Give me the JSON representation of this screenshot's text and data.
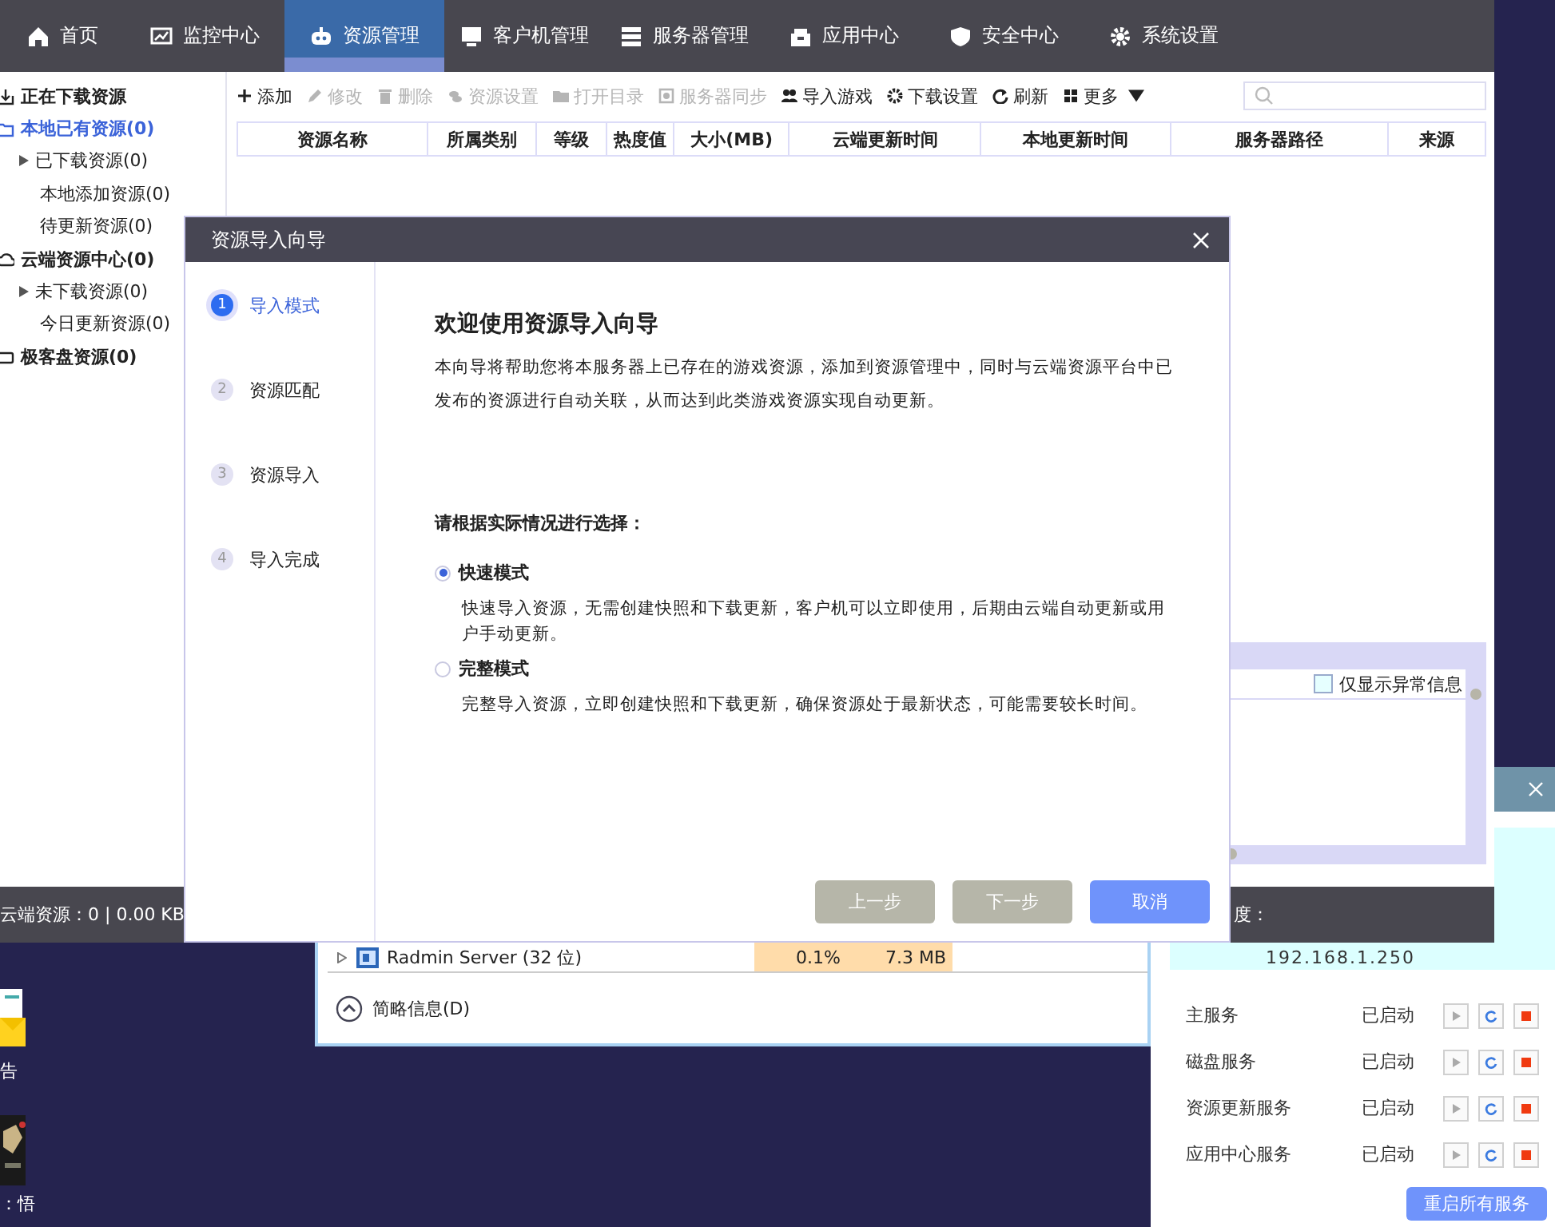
{
  "nav": {
    "items": [
      {
        "label": "首页",
        "selected": false
      },
      {
        "label": "监控中心",
        "selected": false
      },
      {
        "label": "资源管理",
        "selected": true
      },
      {
        "label": "客户机管理",
        "selected": false
      },
      {
        "label": "服务器管理",
        "selected": false
      },
      {
        "label": "应用中心",
        "selected": false
      },
      {
        "label": "安全中心",
        "selected": false
      },
      {
        "label": "系统设置",
        "selected": false
      }
    ]
  },
  "sidebar": {
    "items": [
      {
        "label": "正在下载资源",
        "selected": false
      },
      {
        "label": "本地已有资源(0)",
        "selected": true,
        "children": [
          {
            "label": "已下载资源(0)",
            "kind": "branch",
            "selected": false
          },
          {
            "label": "本地添加资源(0)",
            "kind": "leaf",
            "selected": false
          },
          {
            "label": "待更新资源(0)",
            "kind": "leaf",
            "selected": false
          }
        ]
      },
      {
        "label": "云端资源中心(0)",
        "selected": false,
        "children": [
          {
            "label": "未下载资源(0)",
            "kind": "branch",
            "selected": false
          },
          {
            "label": "今日更新资源(0)",
            "kind": "leaf",
            "selected": false
          }
        ]
      },
      {
        "label": "极客盘资源(0)",
        "selected": false
      }
    ]
  },
  "toolbar": {
    "items": [
      {
        "label": "添加",
        "disabled": false
      },
      {
        "label": "修改",
        "disabled": true
      },
      {
        "label": "删除",
        "disabled": true
      },
      {
        "label": "资源设置",
        "disabled": true
      },
      {
        "label": "打开目录",
        "disabled": true
      },
      {
        "label": "服务器同步",
        "disabled": true
      },
      {
        "label": "导入游戏",
        "disabled": false
      },
      {
        "label": "下载设置",
        "disabled": false
      },
      {
        "label": "刷新",
        "disabled": false
      },
      {
        "label": "更多",
        "disabled": false
      }
    ]
  },
  "table": {
    "columns": [
      "资源名称",
      "所属类别",
      "等级",
      "热度值",
      "大小(MB)",
      "云端更新时间",
      "本地更新时间",
      "服务器路径",
      "来源"
    ]
  },
  "log_panel": {
    "filter": {
      "label": "仅显示异常信息",
      "checked": false
    }
  },
  "status_bar": {
    "left": "云端资源：0 | 0.00 KB",
    "right": "度："
  },
  "dialog": {
    "title": "资源导入向导",
    "steps": [
      {
        "number": "1",
        "label": "导入模式",
        "selected": true
      },
      {
        "number": "2",
        "label": "资源匹配",
        "selected": false
      },
      {
        "number": "3",
        "label": "资源导入",
        "selected": false
      },
      {
        "number": "4",
        "label": "导入完成",
        "selected": false
      }
    ],
    "heading": "欢迎使用资源导入向导",
    "intro": "本向导将帮助您将本服务器上已存在的游戏资源，添加到资源管理中，同时与云端资源平台中已发布的资源进行自动关联，从而达到此类游戏资源实现自动更新。",
    "prompt": "请根据实际情况进行选择：",
    "options": [
      {
        "label": "快速模式",
        "description": "快速导入资源，无需创建快照和下载更新，客户机可以立即使用，后期由云端自动更新或用户手动更新。",
        "selected": true
      },
      {
        "label": "完整模式",
        "description": "完整导入资源，立即创建快照和下载更新，确保资源处于最新状态，可能需要较长时间。",
        "selected": false
      }
    ],
    "buttons": [
      {
        "label": "上一步",
        "disabled": true
      },
      {
        "label": "下一步",
        "disabled": true
      },
      {
        "label": "取消",
        "disabled": false
      }
    ]
  },
  "services_window": {
    "ip": "192.168.1.250",
    "services": [
      {
        "name": "主服务",
        "status": "已启动"
      },
      {
        "name": "磁盘服务",
        "status": "已启动"
      },
      {
        "name": "资源更新服务",
        "status": "已启动"
      },
      {
        "name": "应用中心服务",
        "status": "已启动"
      }
    ],
    "restart_button": "重启所有服务"
  },
  "task_window": {
    "row": {
      "name": "Radmin Server (32 位)",
      "cpu": "0.1%",
      "memory": "7.3 MB"
    },
    "toggle": "简略信息(D)"
  },
  "desktop_icons": [
    {
      "label": "告",
      "kind": "mail"
    },
    {
      "label": "：悟",
      "kind": "game"
    }
  ]
}
